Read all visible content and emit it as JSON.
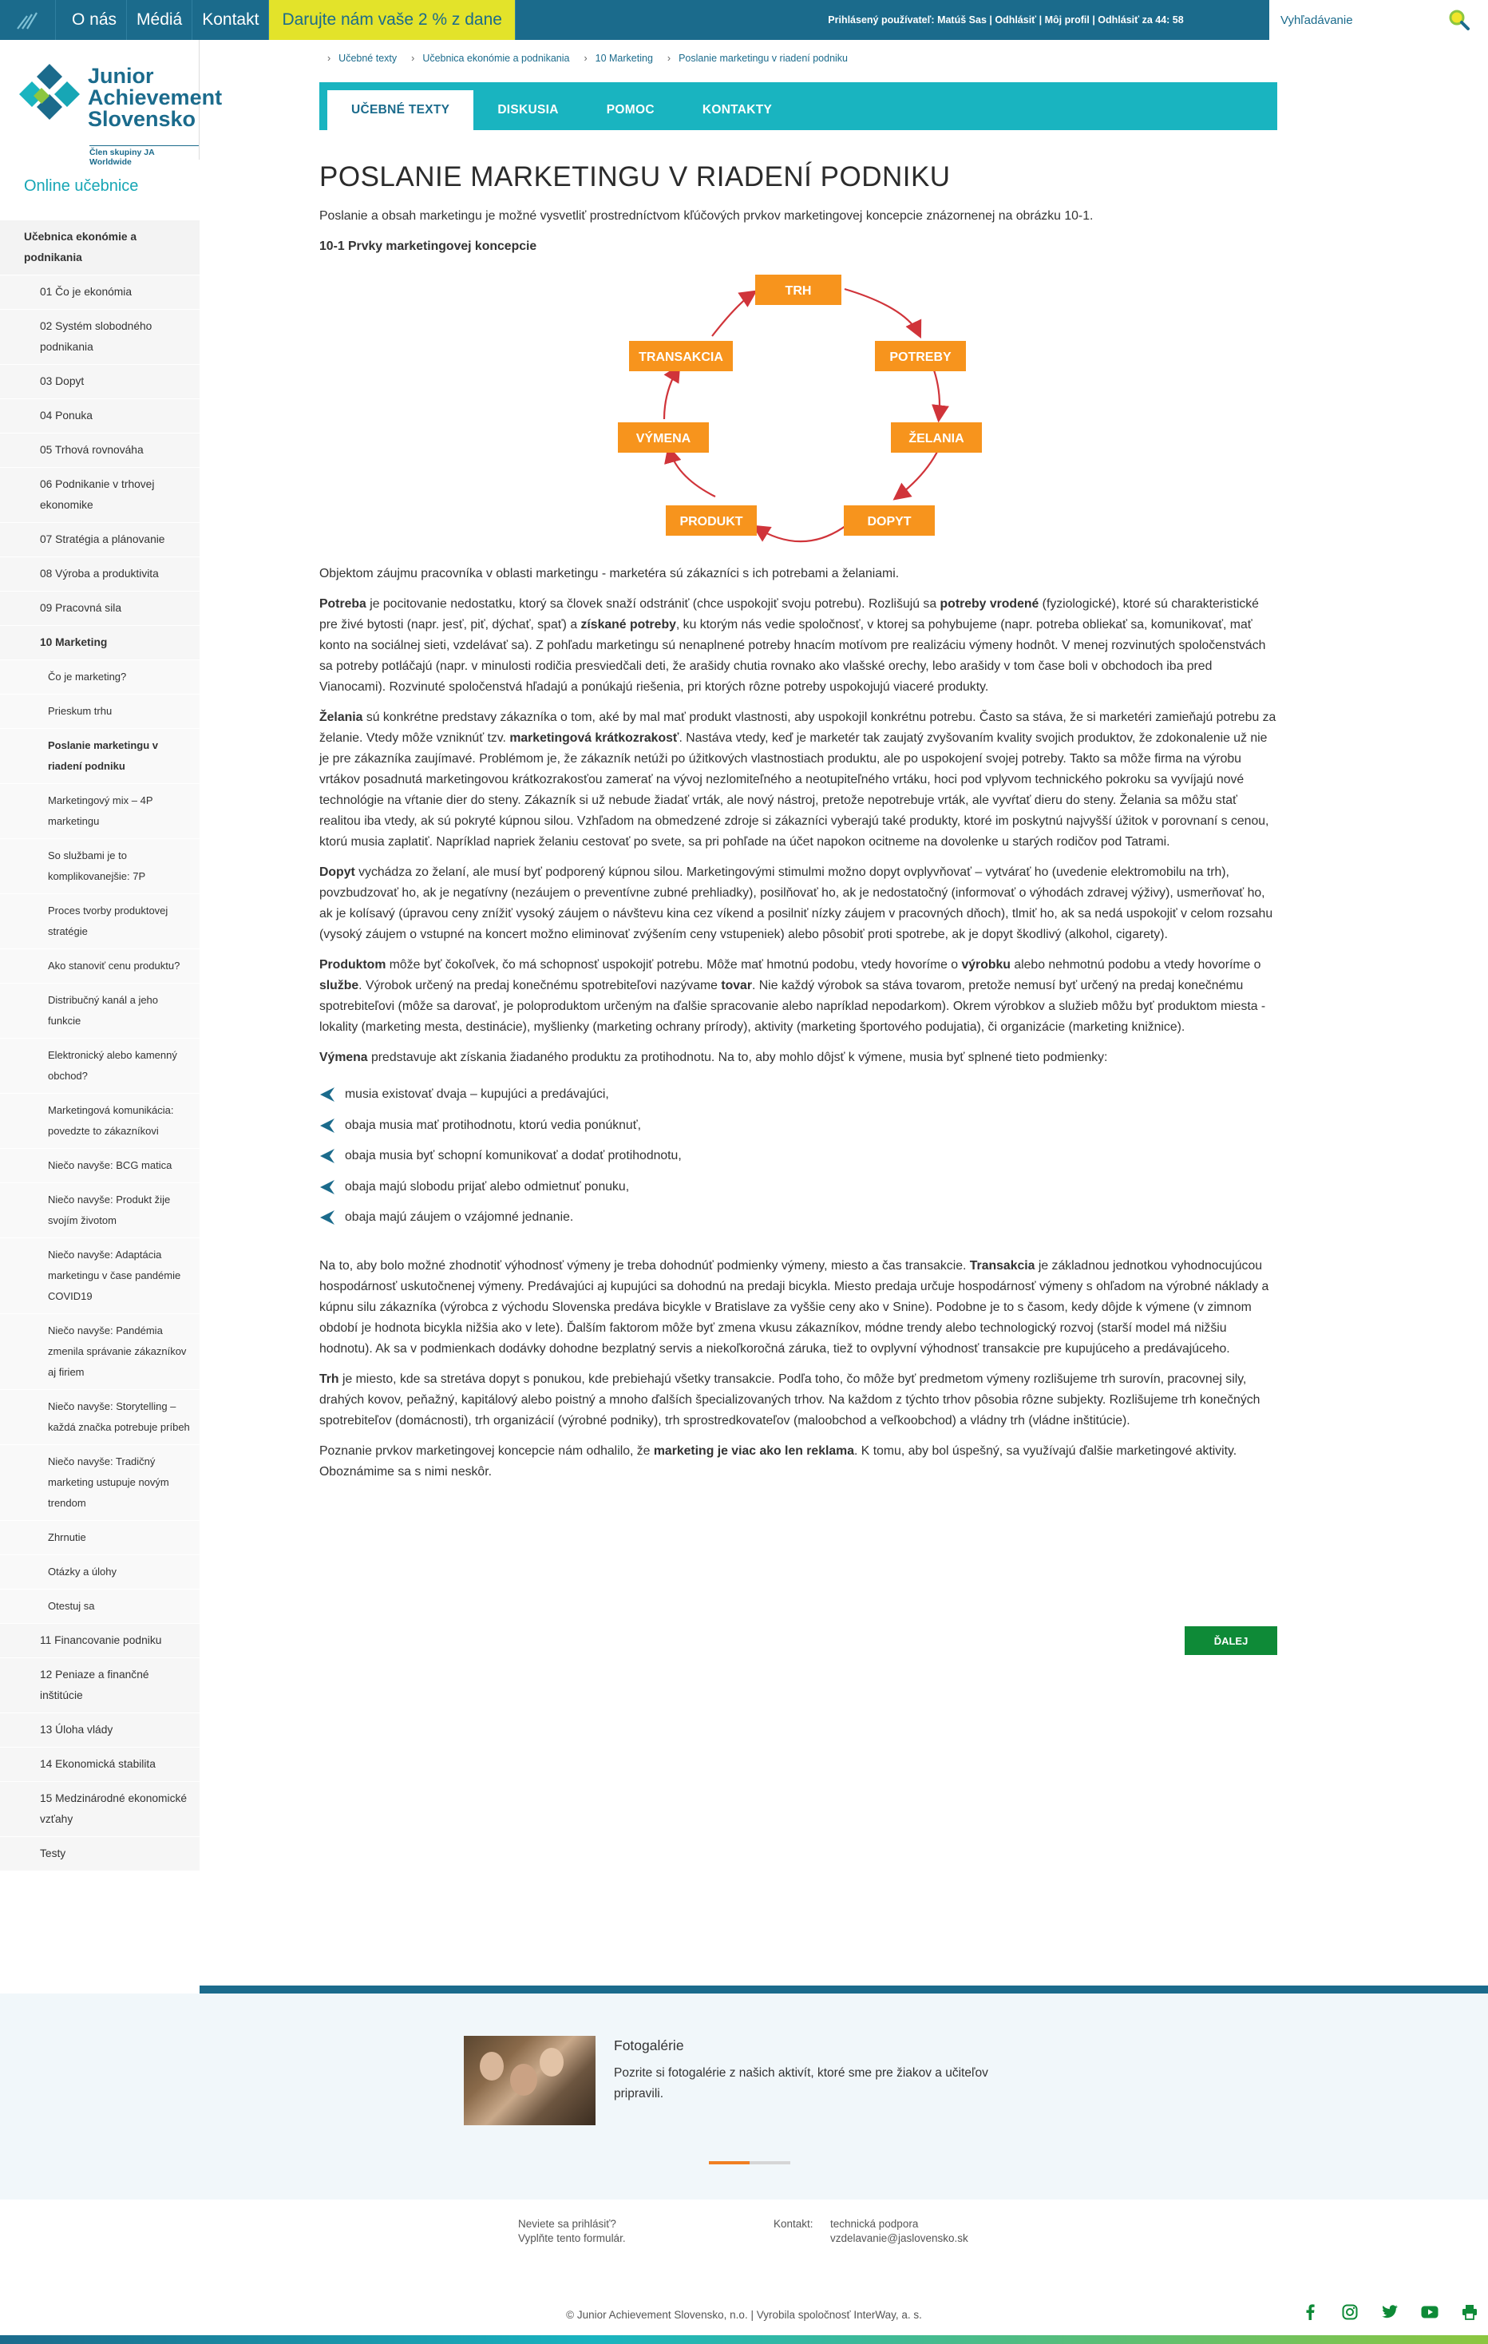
{
  "topbar": {
    "nav": [
      "O nás",
      "Médiá",
      "Kontakt"
    ],
    "promo": "Darujte nám vaše 2 % z dane",
    "user_line": "Prihlásený používateľ: Matúš Sas | Odhlásiť | Môj profil | Odhlásiť za 44: 58",
    "search_placeholder": "Vyhľadávanie"
  },
  "brand": {
    "name_line1": "Junior",
    "name_line2": "Achievement",
    "name_line3": "Slovensko",
    "member": "Člen skupiny JA Worldwide"
  },
  "sidebar": {
    "heading": "Online učebnice",
    "items": [
      {
        "label": "Učebnica ekonómie a podnikania",
        "level": "top"
      },
      {
        "label": "01 Čo je ekonómia",
        "level": "ch"
      },
      {
        "label": "02 Systém slobodného podnikania",
        "level": "ch"
      },
      {
        "label": "03 Dopyt",
        "level": "ch"
      },
      {
        "label": "04 Ponuka",
        "level": "ch"
      },
      {
        "label": "05 Trhová rovnováha",
        "level": "ch"
      },
      {
        "label": "06 Podnikanie v trhovej ekonomike",
        "level": "ch"
      },
      {
        "label": "07 Stratégia a plánovanie",
        "level": "ch"
      },
      {
        "label": "08 Výroba a produktivita",
        "level": "ch"
      },
      {
        "label": "09 Pracovná sila",
        "level": "ch"
      },
      {
        "label": "10 Marketing",
        "level": "ch active"
      },
      {
        "label": "Čo je marketing?",
        "level": "sub"
      },
      {
        "label": "Prieskum trhu",
        "level": "sub"
      },
      {
        "label": "Poslanie marketingu v riadení podniku",
        "level": "sub active"
      },
      {
        "label": "Marketingový mix – 4P marketingu",
        "level": "sub"
      },
      {
        "label": "So službami je to komplikovanejšie: 7P",
        "level": "sub"
      },
      {
        "label": "Proces tvorby produktovej stratégie",
        "level": "sub"
      },
      {
        "label": "Ako stanoviť cenu produktu?",
        "level": "sub"
      },
      {
        "label": "Distribučný kanál a jeho funkcie",
        "level": "sub"
      },
      {
        "label": "Elektronický alebo kamenný obchod?",
        "level": "sub"
      },
      {
        "label": "Marketingová komunikácia: povedzte to zákazníkovi",
        "level": "sub"
      },
      {
        "label": "Niečo navyše: BCG matica",
        "level": "sub"
      },
      {
        "label": "Niečo navyše: Produkt žije svojím životom",
        "level": "sub"
      },
      {
        "label": "Niečo navyše: Adaptácia marketingu v čase pandémie COVID19",
        "level": "sub"
      },
      {
        "label": "Niečo navyše: Pandémia zmenila správanie zákazníkov aj firiem",
        "level": "sub"
      },
      {
        "label": "Niečo navyše: Storytelling – každá značka potrebuje príbeh",
        "level": "sub"
      },
      {
        "label": "Niečo navyše: Tradičný marketing ustupuje novým trendom",
        "level": "sub"
      },
      {
        "label": "Zhrnutie",
        "level": "sub"
      },
      {
        "label": "Otázky a úlohy",
        "level": "sub"
      },
      {
        "label": "Otestuj sa",
        "level": "sub"
      },
      {
        "label": "11 Financovanie podniku",
        "level": "ch"
      },
      {
        "label": "12 Peniaze a finančné inštitúcie",
        "level": "ch"
      },
      {
        "label": "13 Úloha vlády",
        "level": "ch"
      },
      {
        "label": "14 Ekonomická stabilita",
        "level": "ch"
      },
      {
        "label": "15 Medzinárodné ekonomické vzťahy",
        "level": "ch"
      },
      {
        "label": "Testy",
        "level": "ch"
      }
    ]
  },
  "breadcrumb": [
    "Učebné texty",
    "Učebnica ekonómie a podnikania",
    "10 Marketing",
    "Poslanie marketingu v riadení podniku"
  ],
  "tabs": [
    "UČEBNÉ TEXTY",
    "DISKUSIA",
    "POMOC",
    "KONTAKTY"
  ],
  "article": {
    "title": "POSLANIE MARKETINGU V RIADENÍ PODNIKU",
    "intro": "Poslanie a obsah marketingu je možné vysvetliť prostredníctvom kľúčových prvkov marketingovej koncepcie znázornenej na obrázku 10-1.",
    "figure_title": "10-1 Prvky marketingovej koncepcie",
    "diagram_nodes": [
      "TRH",
      "POTREBY",
      "ŽELANIA",
      "DOPYT",
      "PRODUKT",
      "VÝMENA",
      "TRANSAKCIA"
    ],
    "p1": "Objektom záujmu pracovníka v oblasti marketingu - marketéra sú zákazníci s ich potrebami a želaniami.",
    "p2_lead": "Potreba",
    "p2_a": " je pocitovanie nedostatku, ktorý sa človek snaží odstrániť (chce uspokojiť svoju potrebu). Rozlišujú sa ",
    "p2_b1": "potreby vrodené",
    "p2_b": " (fyziologické), ktoré sú charakteristické pre živé bytosti (napr. jesť, piť, dýchať, spať) a ",
    "p2_b2": "získané potreby",
    "p2_c": ", ku ktorým nás vedie spoločnosť, v ktorej sa pohybujeme (napr. potreba obliekať sa, komunikovať, mať konto na sociálnej sieti, vzdelávať sa). Z pohľadu marketingu sú nenaplnené potreby hnacím motívom pre realizáciu výmeny hodnôt. V menej rozvinutých spoločenstvách sa potreby potláčajú (napr. v minulosti rodičia presviedčali deti, že arašidy chutia rovnako ako vlašské orechy, lebo arašidy v tom čase boli v obchodoch iba pred Vianocami). Rozvinuté spoločenstvá hľadajú a ponúkajú riešenia, pri ktorých rôzne potreby uspokojujú viaceré produkty.",
    "p3_lead": "Želania",
    "p3_a": " sú konkrétne predstavy zákazníka o tom, aké by mal mať produkt vlastnosti, aby uspokojil konkrétnu potrebu. Často sa stáva, že si marketéri zamieňajú potrebu za želanie. Vtedy môže vzniknúť tzv. ",
    "p3_b1": "marketingová krátkozrakosť",
    "p3_b": ". Nastáva vtedy, keď je marketér tak zaujatý zvyšovaním kvality svojich produktov, že zdokonalenie už nie je pre zákazníka zaujímavé. Problémom je, že zákazník netúži po úžitkových vlastnostiach produktu, ale po uspokojení svojej potreby. Takto sa môže firma na výrobu vrtákov posadnutá marketingovou krátkozrakosťou zamerať na vývoj nezlomiteľného a neotupiteľného vrtáku, hoci pod vplyvom technického pokroku sa vyvíjajú nové technológie na vŕtanie dier do steny. Zákazník si už nebude žiadať vrták, ale nový nástroj, pretože nepotrebuje vrták, ale vyvŕtať dieru do steny. Želania sa môžu stať realitou iba vtedy, ak sú pokryté kúpnou silou. Vzhľadom na obmedzené zdroje si zákazníci vyberajú také produkty, ktoré im poskytnú najvyšší úžitok v porovnaní s cenou, ktorú musia zaplatiť. Napríklad napriek želaniu cestovať po svete, sa pri pohľade na účet napokon ocitneme na dovolenke u starých rodičov pod Tatrami.",
    "p4_lead": "Dopyt",
    "p4_a": " vychádza zo želaní, ale musí byť podporený kúpnou silou. Marketingovými stimulmi možno dopyt ovplyvňovať – vytvárať ho (uvedenie elektromobilu na trh), povzbudzovať ho, ak je negatívny (nezáujem o preventívne zubné prehliadky), posilňovať ho, ak je nedostatočný (informovať o výhodách zdravej výživy), usmerňovať ho, ak je kolísavý (úpravou ceny znížiť vysoký záujem o návštevu kina cez víkend a posilniť nízky záujem v pracovných dňoch), tlmiť ho, ak sa nedá uspokojiť v celom rozsahu (vysoký záujem o vstupné na koncert možno eliminovať zvýšením ceny vstupeniek) alebo pôsobiť proti spotrebe, ak je dopyt škodlivý (alkohol, cigarety).",
    "p5_lead": "Produktom",
    "p5_a": " môže byť čokoľvek, čo má schopnosť uspokojiť potrebu. Môže mať hmotnú podobu, vtedy hovoríme o ",
    "p5_b1": "výrobku",
    "p5_b": " alebo nehmotnú podobu a vtedy hovoríme o ",
    "p5_b2": "službe",
    "p5_c": ". Výrobok určený na predaj konečnému spotrebiteľovi nazývame ",
    "p5_b3": "tovar",
    "p5_d": ". Nie každý výrobok sa stáva tovarom, pretože nemusí byť určený na predaj konečnému spotrebiteľovi (môže sa darovať, je poloproduktom určeným na ďalšie spracovanie alebo napríklad nepodarkom). Okrem výrobkov a služieb môžu byť produktom miesta - lokality (marketing mesta, destinácie), myšlienky (marketing ochrany prírody), aktivity (marketing športového podujatia), či organizácie (marketing knižnice).",
    "p6_lead": "Výmena",
    "p6_a": " predstavuje akt získania žiadaného produktu za protihodnotu. Na to, aby mohlo dôjsť k výmene, musia byť splnené tieto podmienky:",
    "conditions": [
      "musia existovať dvaja – kupujúci a predávajúci,",
      "obaja musia mať protihodnotu, ktorú vedia ponúknuť,",
      "obaja musia byť schopní komunikovať a dodať protihodnotu,",
      "obaja majú slobodu prijať alebo odmietnuť ponuku,",
      "obaja majú záujem o vzájomné jednanie."
    ],
    "p7_a": "Na to, aby bolo možné zhodnotiť výhodnosť výmeny je treba dohodnúť podmienky výmeny, miesto a čas transakcie. ",
    "p7_lead": "Transakcia",
    "p7_b": " je základnou jednotkou vyhodnocujúcou hospodárnosť uskutočnenej výmeny. Predávajúci aj kupujúci sa dohodnú na predaji bicykla. Miesto predaja určuje hospodárnosť výmeny s ohľadom na výrobné náklady a kúpnu silu zákazníka (výrobca z východu Slovenska predáva bicykle v Bratislave za vyššie ceny ako v Snine). Podobne je to s časom, kedy dôjde k výmene (v zimnom období je hodnota bicykla nižšia ako v lete). Ďalším faktorom môže byť zmena vkusu zákazníkov, módne trendy alebo technologický rozvoj (starší model má nižšiu hodnotu). Ak sa v podmienkach dodávky dohodne bezplatný servis a niekoľkoročná záruka, tiež to ovplyvní výhodnosť transakcie pre kupujúceho a predávajúceho.",
    "p8_lead": "Trh",
    "p8_a": " je miesto, kde sa stretáva dopyt s ponukou, kde prebiehajú všetky transakcie. Podľa toho, čo môže byť predmetom výmeny rozlišujeme trh surovín, pracovnej sily, drahých kovov, peňažný, kapitálový alebo poistný a mnoho ďalších špecializovaných trhov. Na každom z týchto trhov pôsobia rôzne subjekty. Rozlišujeme trh konečných spotrebiteľov (domácnosti), trh organizácií (výrobné podniky), trh sprostredkovateľov (maloobchod a veľkoobchod) a vládny trh (vládne inštitúcie).",
    "p9_a": "Poznanie prvkov marketingovej koncepcie nám odhalilo, že ",
    "p9_b": "marketing je viac ako len reklama",
    "p9_c": ". K tomu, aby bol úspešný, sa využívajú ďalšie marketingové aktivity. Oboznámime sa s nimi neskôr.",
    "next": "ĎALEJ"
  },
  "gallery": {
    "title": "Fotogalérie",
    "text": "Pozrite si fotogalérie z našich aktivít, ktoré sme pre žiakov a učiteľov pripravili.",
    "slider_progress": 0.5
  },
  "footer": {
    "login_q": "Neviete sa prihlásiť?",
    "login_a": "Vyplňte tento formulár.",
    "contact_label": "Kontakt:",
    "contact_1": "technická podpora",
    "contact_2": "vzdelavanie@jaslovensko.sk",
    "copyright": "© Junior Achievement Slovensko, n.o. | Vyrobila spoločnosť InterWay, a. s."
  },
  "colors": {
    "primary": "#1b6b8c",
    "tabs": "#19b4c0",
    "node": "#f7941d",
    "arrow": "#d0343a",
    "next": "#0e8a37",
    "promo": "#e3e32a"
  }
}
